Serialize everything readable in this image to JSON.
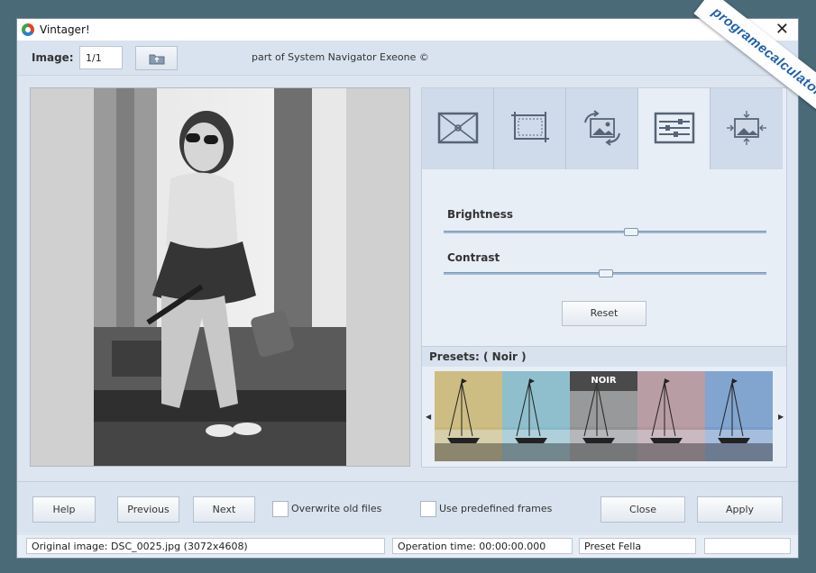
{
  "window": {
    "title": "Vintager!",
    "close_symbol": "✕"
  },
  "toolbar": {
    "image_label": "Image:",
    "image_value": "1/1",
    "copyright": "part of System Navigator Exeone ©"
  },
  "watermark": {
    "text": "programecalculator.ro"
  },
  "panel": {
    "tabs": [
      {
        "icon": "frame-icon",
        "active": false
      },
      {
        "icon": "crop-icon",
        "active": false
      },
      {
        "icon": "rotate-image-icon",
        "active": false
      },
      {
        "icon": "adjust-sliders-icon",
        "active": true
      },
      {
        "icon": "resize-icon",
        "active": false
      }
    ],
    "brightness_label": "Brightness",
    "brightness_value": 0.58,
    "contrast_label": "Contrast",
    "contrast_value": 0.5,
    "reset_label": "Reset",
    "presets_label": "Presets: ( Noir )",
    "presets": [
      {
        "label": "",
        "tint": "#c8b46e"
      },
      {
        "label": "",
        "tint": "#7fb6c4"
      },
      {
        "label": "NOIR",
        "tint": "#8a8a8a"
      },
      {
        "label": "",
        "tint": "#b08e96"
      },
      {
        "label": "",
        "tint": "#6f98c8"
      }
    ]
  },
  "buttons": {
    "help": "Help",
    "previous": "Previous",
    "next": "Next",
    "overwrite": "Overwrite old files",
    "use_frames": "Use predefined frames",
    "close": "Close",
    "apply": "Apply"
  },
  "status": {
    "original": "Original image: DSC_0025.jpg (3072x4608)",
    "operation": "Operation time: 00:00:00.000",
    "preset": "Preset Fella",
    "extra": ""
  }
}
